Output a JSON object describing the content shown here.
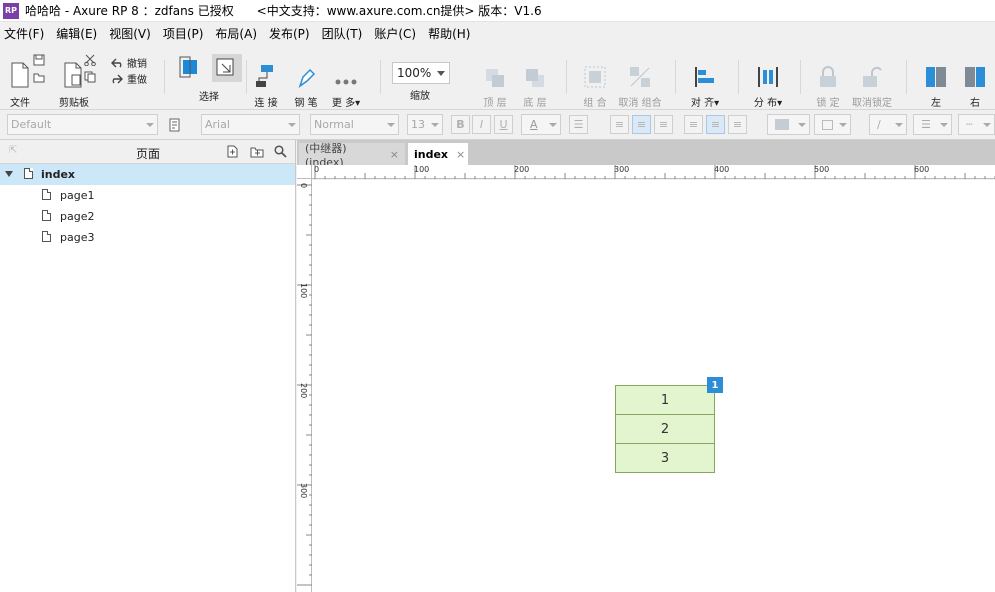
{
  "window": {
    "title": "哈哈哈 - Axure RP 8 ：zdfans 已授权      <中文支持：www.axure.com.cn提供> 版本：V1.6",
    "logo_text": "RP"
  },
  "menu": [
    "文件(F)",
    "编辑(E)",
    "视图(V)",
    "项目(P)",
    "布局(A)",
    "发布(P)",
    "团队(T)",
    "账户(C)",
    "帮助(H)"
  ],
  "toolbar": {
    "file": "文件",
    "clipboard": "剪贴板",
    "undo": "撤销",
    "redo": "重做",
    "select": "选择",
    "connect": "连 接",
    "pen": "钢 笔",
    "more": "更 多▾",
    "zoom_value": "100%",
    "zoom_label": "缩放",
    "top": "顶 层",
    "bottom": "底 层",
    "group": "组 合",
    "ungroup": "取消 组合",
    "align": "对 齐▾",
    "distribute": "分 布▾",
    "lock": "锁 定",
    "unlock": "取消锁定",
    "left": "左",
    "right": "右"
  },
  "format": {
    "style": "Default",
    "font": "Arial",
    "weight": "Normal",
    "size": "13",
    "bold": "B",
    "italic": "I",
    "underline": "U",
    "font_color": "A"
  },
  "pages": {
    "title": "页面",
    "items": [
      {
        "label": "index",
        "level": 0,
        "selected": true
      },
      {
        "label": "page1",
        "level": 1
      },
      {
        "label": "page2",
        "level": 1
      },
      {
        "label": "page3",
        "level": 1
      }
    ]
  },
  "tabs": [
    {
      "label": "(中继器) (index)",
      "close": "×",
      "active": false
    },
    {
      "label": "index",
      "close": "×",
      "active": true
    }
  ],
  "ruler": {
    "h_labels": [
      "0",
      "100",
      "200",
      "300",
      "400",
      "500",
      "600"
    ],
    "v_labels": [
      "0",
      "100",
      "200",
      "300"
    ]
  },
  "canvas": {
    "repeater_rows": [
      "1",
      "2",
      "3"
    ],
    "badge": "1",
    "row_fill": "#e2f5cf",
    "row_border": "#86a760",
    "badge_color": "#2b8ed6"
  }
}
